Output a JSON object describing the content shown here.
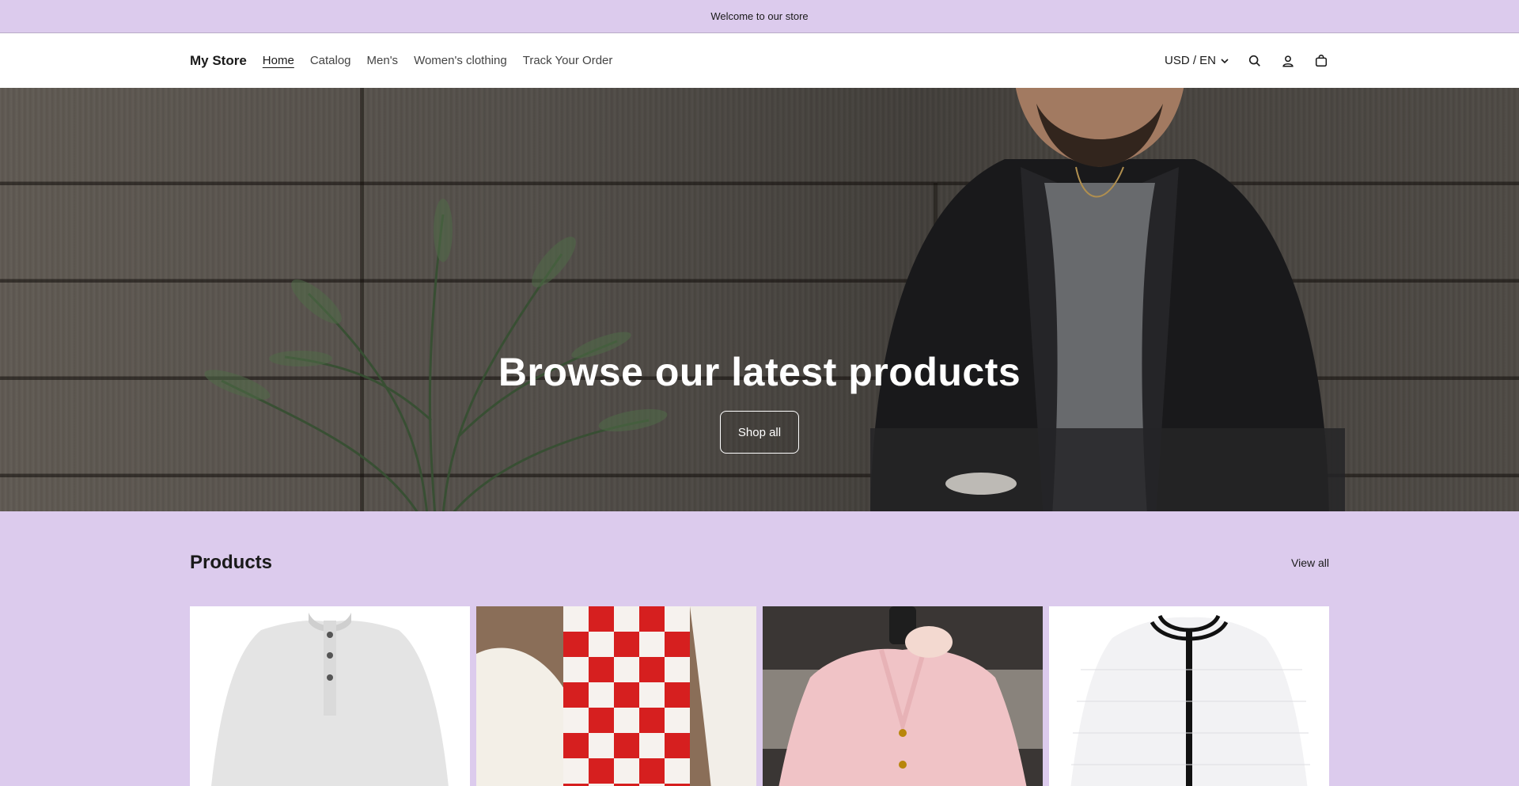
{
  "announcement": {
    "text": "Welcome to our store"
  },
  "header": {
    "logo": "My Store",
    "nav": [
      {
        "label": "Home",
        "active": true
      },
      {
        "label": "Catalog",
        "active": false
      },
      {
        "label": "Men's",
        "active": false
      },
      {
        "label": "Women's clothing",
        "active": false
      },
      {
        "label": "Track Your Order",
        "active": false
      }
    ],
    "currency": "USD / EN",
    "icons": [
      "search-icon",
      "account-icon",
      "cart-icon"
    ]
  },
  "hero": {
    "title": "Browse our latest products",
    "button": "Shop all"
  },
  "products": {
    "title": "Products",
    "view_all": "View all",
    "items": [
      {
        "image": "white-henley-shirt"
      },
      {
        "image": "red-checkered-vest"
      },
      {
        "image": "pink-cardigan"
      },
      {
        "image": "white-zip-jacket"
      }
    ]
  },
  "colors": {
    "accent": "#dccbed",
    "header_bg": "#ffffff",
    "text": "#1a1a1a"
  }
}
